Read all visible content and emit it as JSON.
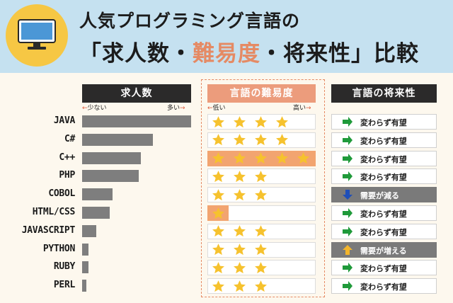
{
  "header": {
    "title_line1": "人気プログラミング言語の",
    "title_line2_open": "「求人数・",
    "title_line2_accent": "難易度",
    "title_line2_close": "・将来性」比較"
  },
  "columns": {
    "job": {
      "title": "求人数",
      "scale_low": "少ない",
      "scale_high": "多い"
    },
    "difficulty": {
      "title": "言語の難易度",
      "scale_low": "低い",
      "scale_high": "高い"
    },
    "future": {
      "title": "言語の将来性"
    }
  },
  "languages": [
    {
      "name": "JAVA",
      "jobs": 1.0,
      "stars": 4,
      "future": "変わらず有望",
      "trend": "same"
    },
    {
      "name": "C#",
      "jobs": 0.65,
      "stars": 4,
      "future": "変わらず有望",
      "trend": "same"
    },
    {
      "name": "C++",
      "jobs": 0.54,
      "stars": 5,
      "future": "変わらず有望",
      "trend": "same"
    },
    {
      "name": "PHP",
      "jobs": 0.52,
      "stars": 3,
      "future": "変わらず有望",
      "trend": "same"
    },
    {
      "name": "COBOL",
      "jobs": 0.28,
      "stars": 3,
      "future": "需要が減る",
      "trend": "down"
    },
    {
      "name": "HTML/CSS",
      "jobs": 0.25,
      "stars": 1,
      "future": "変わらず有望",
      "trend": "same"
    },
    {
      "name": "JAVASCRIPT",
      "jobs": 0.13,
      "stars": 3,
      "future": "変わらず有望",
      "trend": "same"
    },
    {
      "name": "PYTHON",
      "jobs": 0.06,
      "stars": 3,
      "future": "需要が増える",
      "trend": "up"
    },
    {
      "name": "RUBY",
      "jobs": 0.06,
      "stars": 3,
      "future": "変わらず有望",
      "trend": "same"
    },
    {
      "name": "PERL",
      "jobs": 0.04,
      "stars": 3,
      "future": "変わらず有望",
      "trend": "same"
    }
  ],
  "colors": {
    "background": "#c5e1f0",
    "panel": "#fdf8ee",
    "accent": "#e58a64",
    "star": "#f6c22e",
    "highlight": "#f2a470",
    "arrow_same": "#1f9a3a",
    "arrow_down": "#1f4fb8",
    "arrow_up": "#f3b52c"
  },
  "icons": {
    "badge": "desktop-computer-icon",
    "star": "star-icon",
    "same": "arrow-right-icon",
    "down": "arrow-down-icon",
    "up": "arrow-up-icon"
  }
}
